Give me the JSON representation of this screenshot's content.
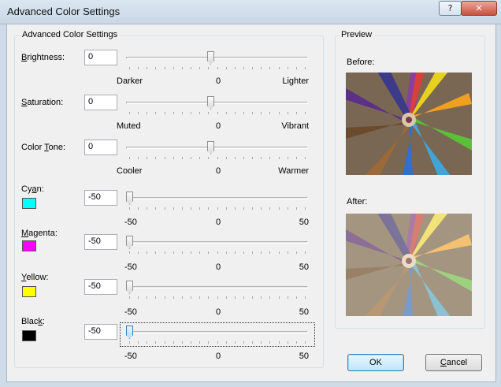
{
  "window": {
    "title": "Advanced Color Settings",
    "help_glyph": "?",
    "close_glyph": "✕"
  },
  "settings_group": {
    "title": "Advanced Color Settings"
  },
  "preview_group": {
    "title": "Preview",
    "before_label": "Before:",
    "after_label": "After:"
  },
  "rows": {
    "brightness": {
      "label_pre": "",
      "label_key": "B",
      "label_post": "rightness:",
      "value": "0",
      "slider_fraction": 0.5,
      "min_label": "Darker",
      "mid_label": "0",
      "max_label": "Lighter"
    },
    "saturation": {
      "label_pre": "",
      "label_key": "S",
      "label_post": "aturation:",
      "value": "0",
      "slider_fraction": 0.5,
      "min_label": "Muted",
      "mid_label": "0",
      "max_label": "Vibrant"
    },
    "tone": {
      "label_pre": "Color ",
      "label_key": "T",
      "label_post": "one:",
      "value": "0",
      "slider_fraction": 0.5,
      "min_label": "Cooler",
      "mid_label": "0",
      "max_label": "Warmer"
    },
    "cyan": {
      "label_pre": "Cy",
      "label_key": "a",
      "label_post": "n:",
      "value": "-50",
      "slider_fraction": 0,
      "min_label": "-50",
      "mid_label": "0",
      "max_label": "50",
      "swatch": "#00ffff"
    },
    "magenta": {
      "label_pre": "",
      "label_key": "M",
      "label_post": "agenta:",
      "value": "-50",
      "slider_fraction": 0,
      "min_label": "-50",
      "mid_label": "0",
      "max_label": "50",
      "swatch": "#ff00ff"
    },
    "yellow": {
      "label_pre": "",
      "label_key": "Y",
      "label_post": "ellow:",
      "value": "-50",
      "slider_fraction": 0,
      "min_label": "-50",
      "mid_label": "0",
      "max_label": "50",
      "swatch": "#ffff00"
    },
    "black": {
      "label_pre": "Blac",
      "label_key": "k",
      "label_post": ":",
      "value": "-50",
      "slider_fraction": 0,
      "min_label": "-50",
      "mid_label": "0",
      "max_label": "50",
      "swatch": "#000000"
    }
  },
  "buttons": {
    "ok": "OK",
    "cancel_key": "C",
    "cancel_rest": "ancel"
  }
}
